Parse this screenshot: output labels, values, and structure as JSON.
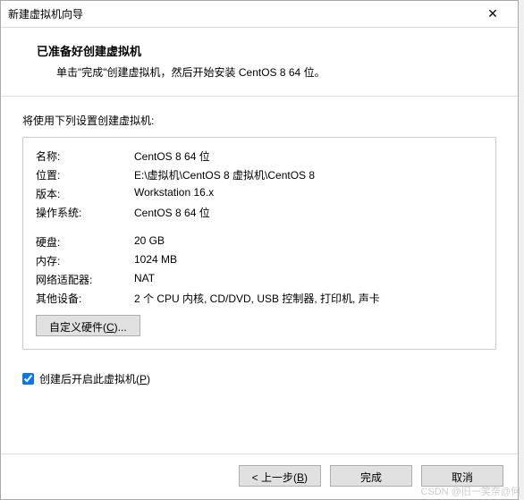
{
  "titlebar": {
    "title": "新建虚拟机向导",
    "close": "✕"
  },
  "header": {
    "title": "已准备好创建虚拟机",
    "subtitle": "单击\"完成\"创建虚拟机，然后开始安装 CentOS 8 64 位。"
  },
  "intro": "将使用下列设置创建虚拟机:",
  "rows": [
    {
      "label": "名称:",
      "value": "CentOS 8 64 位"
    },
    {
      "label": "位置:",
      "value": "E:\\虚拟机\\CentOS 8 虚拟机\\CentOS 8"
    },
    {
      "label": "版本:",
      "value": "Workstation 16.x"
    },
    {
      "label": "操作系统:",
      "value": "CentOS 8 64 位"
    }
  ],
  "rows2": [
    {
      "label": "硬盘:",
      "value": "20 GB"
    },
    {
      "label": "内存:",
      "value": "1024 MB"
    },
    {
      "label": "网络适配器:",
      "value": "NAT"
    },
    {
      "label": "其他设备:",
      "value": "2 个 CPU 内核, CD/DVD, USB 控制器, 打印机, 声卡"
    }
  ],
  "customize": {
    "prefix": "自定义硬件(",
    "key": "C",
    "suffix": ")..."
  },
  "checkbox": {
    "prefix": "创建后开启此虚拟机(",
    "key": "P",
    "suffix": ")",
    "checked": true
  },
  "footer": {
    "back": {
      "prefix": "< 上一步(",
      "key": "B",
      "suffix": ")"
    },
    "finish": "完成",
    "cancel": "取消"
  },
  "watermark": "CSDN @旧一笑奈@何"
}
